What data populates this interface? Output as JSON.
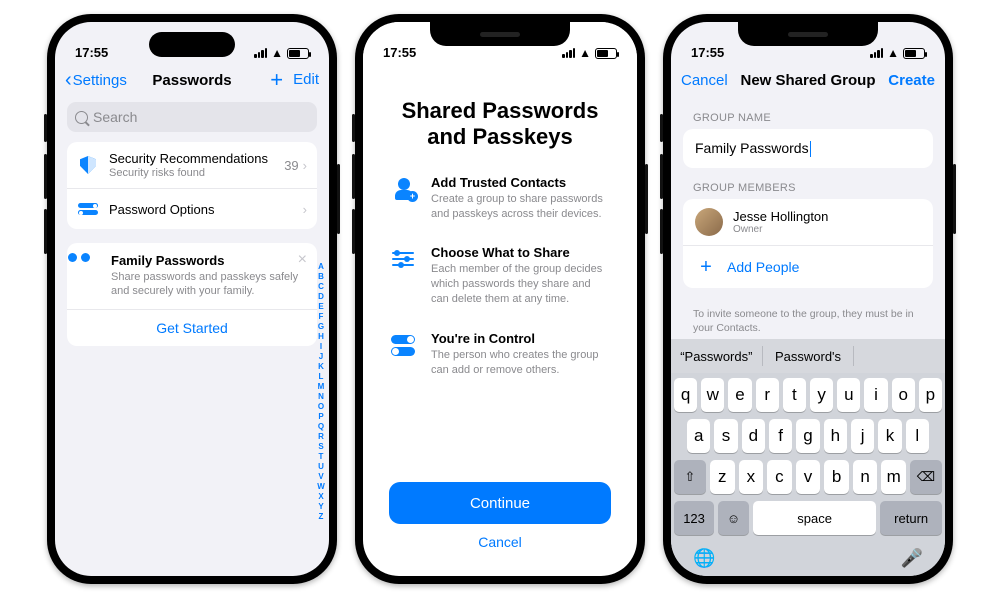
{
  "status": {
    "time": "17:55"
  },
  "index_letters": [
    "A",
    "B",
    "C",
    "D",
    "E",
    "F",
    "G",
    "H",
    "I",
    "J",
    "K",
    "L",
    "M",
    "N",
    "O",
    "P",
    "Q",
    "R",
    "S",
    "T",
    "U",
    "V",
    "W",
    "X",
    "Y",
    "Z"
  ],
  "screen1": {
    "back_label": "Settings",
    "title": "Passwords",
    "edit_label": "Edit",
    "search_placeholder": "Search",
    "rows": {
      "security": {
        "title": "Security Recommendations",
        "subtitle": "Security risks found",
        "count": "39"
      },
      "options": {
        "title": "Password Options"
      }
    },
    "family": {
      "title": "Family Passwords",
      "subtitle": "Share passwords and passkeys safely and securely with your family.",
      "cta": "Get Started"
    }
  },
  "screen2": {
    "title_line1": "Shared Passwords",
    "title_line2": "and Passkeys",
    "features": [
      {
        "title": "Add Trusted Contacts",
        "subtitle": "Create a group to share passwords and passkeys across their devices."
      },
      {
        "title": "Choose What to Share",
        "subtitle": "Each member of the group decides which passwords they share and can delete them at any time."
      },
      {
        "title": "You're in Control",
        "subtitle": "The person who creates the group can add or remove others."
      }
    ],
    "continue": "Continue",
    "cancel": "Cancel"
  },
  "screen3": {
    "cancel": "Cancel",
    "title": "New Shared Group",
    "create": "Create",
    "group_name_label": "GROUP NAME",
    "group_name_value": "Family Passwords",
    "members_label": "GROUP MEMBERS",
    "member": {
      "name": "Jesse Hollington",
      "role": "Owner"
    },
    "add_people": "Add People",
    "hint": "To invite someone to the group, they must be in your Contacts.",
    "suggestions": [
      "“Passwords”",
      "Password's",
      ""
    ],
    "keyboard": {
      "row1": [
        "q",
        "w",
        "e",
        "r",
        "t",
        "y",
        "u",
        "i",
        "o",
        "p"
      ],
      "row2": [
        "a",
        "s",
        "d",
        "f",
        "g",
        "h",
        "j",
        "k",
        "l"
      ],
      "row3": [
        "z",
        "x",
        "c",
        "v",
        "b",
        "n",
        "m"
      ],
      "num": "123",
      "space": "space",
      "ret": "return"
    }
  }
}
